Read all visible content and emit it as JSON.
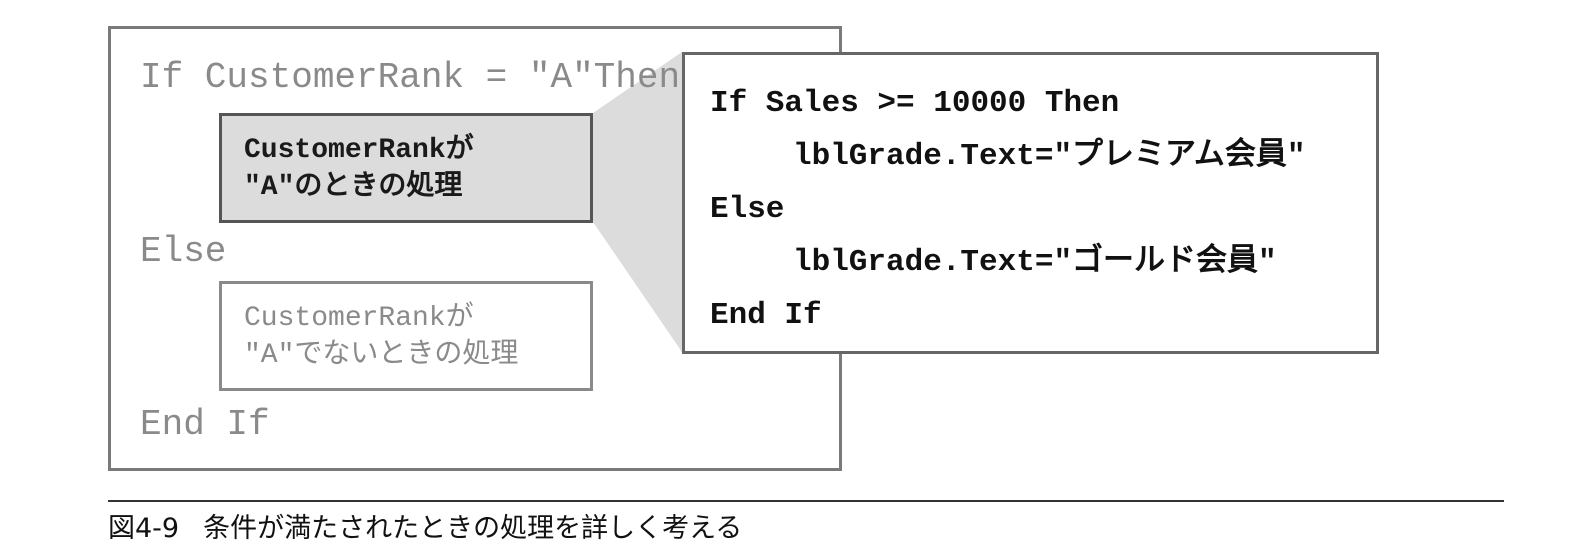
{
  "outer_code": {
    "if_line": "If CustomerRank = \"A\"Then",
    "else_line": "Else",
    "endif_line": "End If"
  },
  "then_block": {
    "line1": "CustomerRankが",
    "line2": "\"A\"のときの処理"
  },
  "else_block": {
    "line1": "CustomerRankが",
    "line2": "\"A\"でないときの処理"
  },
  "detail_code": {
    "line1": "If Sales >= 10000 Then",
    "line2": "lblGrade.Text=\"プレミアム会員\"",
    "line3": "Else",
    "line4": "lblGrade.Text=\"ゴールド会員\"",
    "line5": "End If"
  },
  "caption": {
    "number": "図4-9",
    "text": "条件が満たされたときの処理を詳しく考える"
  },
  "colors": {
    "highlight_fill": "#dcdcdc",
    "wedge_fill": "#dcdcdc",
    "muted_text": "#8a8a8a"
  }
}
